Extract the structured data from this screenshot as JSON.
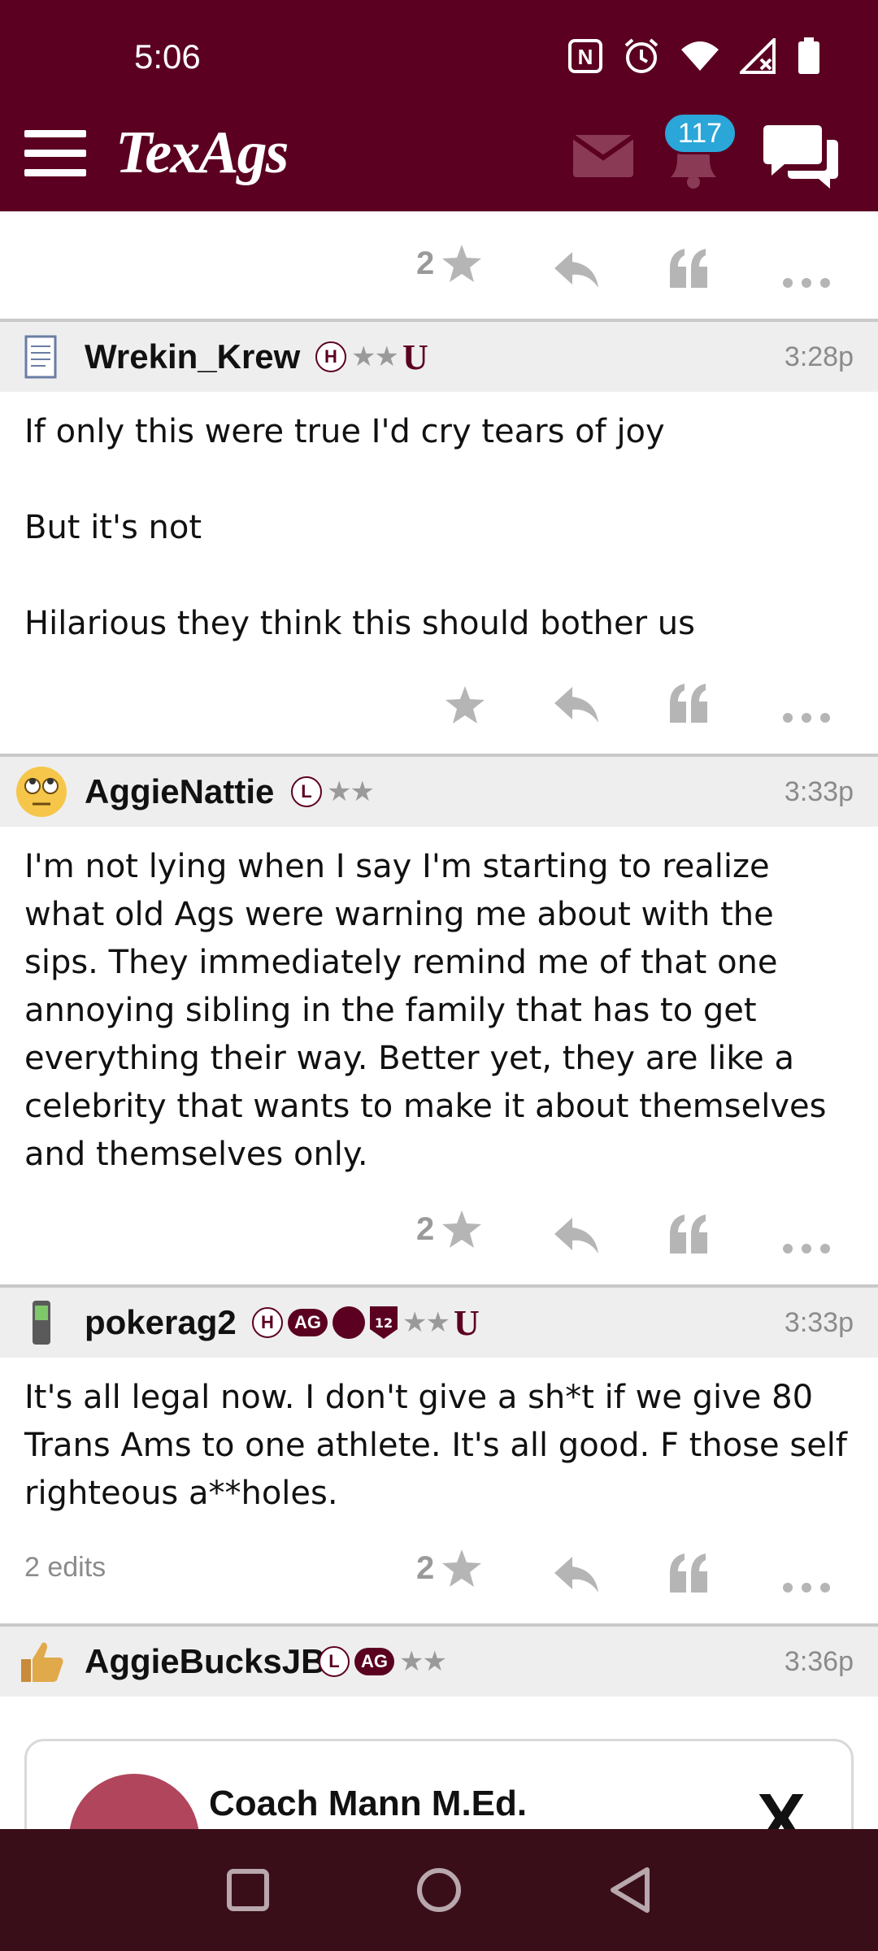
{
  "status_bar": {
    "time": "5:06"
  },
  "header": {
    "logo": "TexAgs",
    "notification_count": "117"
  },
  "top_actions": {
    "star_count": "2"
  },
  "posts": [
    {
      "username": "Wrekin_Krew",
      "badges": [
        "H",
        "★★",
        "U"
      ],
      "time": "3:28p",
      "avatar": "notepad-icon",
      "body": "If only this were true I'd cry tears of joy\n\nBut it's not\n\nHilarious they think this should bother us",
      "star_count": ""
    },
    {
      "username": "AggieNattie",
      "badges": [
        "L",
        "★★"
      ],
      "time": "3:33p",
      "avatar": "rolling-eyes-emoji",
      "body": "I'm not lying when I say I'm starting to realize what old Ags were warning me about with the sips. They immediately remind me of that one annoying sibling in the family that has to get everything their way. Better yet, they are like a celebrity that wants to make it about themselves and themselves only.",
      "star_count": "2"
    },
    {
      "username": "pokerag2",
      "badges": [
        "H",
        "AG",
        "12",
        "★★",
        "U"
      ],
      "time": "3:33p",
      "avatar": "phone-icon",
      "body": "It's all legal now. I don't give a sh*t if we give 80 Trans Ams to one athlete. It's all good. F those self righteous a**holes.",
      "star_count": "2",
      "edits": "2 edits"
    },
    {
      "username": "AggieBucksJB",
      "badges": [
        "L",
        "AG",
        "★★"
      ],
      "time": "3:36p",
      "avatar": "thumbs-up-icon",
      "embed": {
        "name": "Coach Mann M.Ed.",
        "logo": "X"
      }
    }
  ],
  "colors": {
    "maroon": "#5b0021",
    "navbar": "#3a0e19",
    "badge_blue": "#2aa6d8"
  }
}
